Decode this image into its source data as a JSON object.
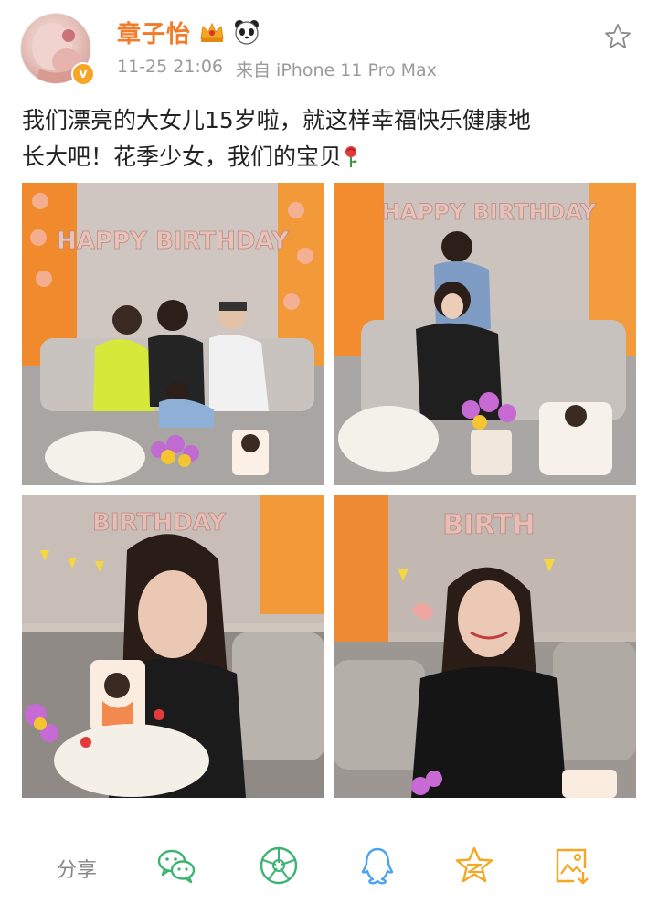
{
  "post": {
    "username": "章子怡",
    "timestamp": "11-25 21:06",
    "source": "来自 iPhone 11 Pro Max",
    "text_line1": "我们漂亮的大女儿15岁啦，就这样幸福快乐健康地",
    "text_line2": "长大吧！花季少女，我们的宝贝",
    "icons": {
      "crown": "crown-icon",
      "panda": "panda-icon",
      "verified": "verified-badge-icon",
      "favorite": "star-outline-icon",
      "rose": "rose-icon"
    }
  },
  "photos": {
    "photo1": {
      "banner": "HAPPY BIRTHDAY"
    },
    "photo2": {
      "banner": "HAPPY BIRTHDAY"
    },
    "photo3": {
      "banner": "BIRTHDAY"
    },
    "photo4": {
      "banner": "BIRTH"
    }
  },
  "footer": {
    "share_label": "分享",
    "icons": [
      "wechat-icon",
      "moments-icon",
      "qq-icon",
      "qzone-icon",
      "save-image-icon"
    ]
  },
  "colors": {
    "username": "#f27b2a",
    "meta": "#9a9a9a",
    "icon_green": "#3cb371",
    "icon_blue": "#4aa3f0",
    "icon_orange": "#f5a623"
  }
}
